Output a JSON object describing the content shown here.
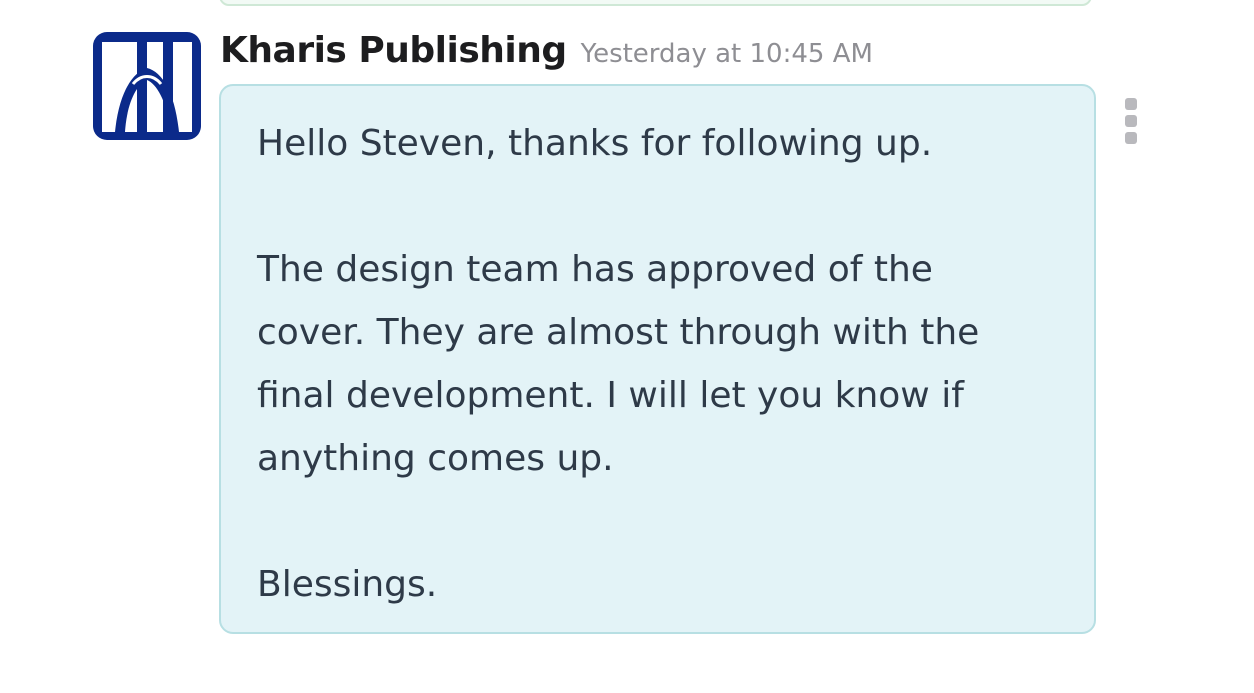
{
  "message": {
    "sender": "Kharis Publishing",
    "timestamp": "Yesterday at 10:45 AM",
    "avatar_icon": "kharis-publishing-logo-icon",
    "lines": [
      "Hello Steven, thanks for following up.",
      "",
      "The design team has approved of the",
      "cover. They are almost through with the",
      "final development. I will let you know if",
      "anything comes up.",
      "",
      "Blessings."
    ]
  },
  "colors": {
    "bubble_background": "#e3f3f7",
    "bubble_border": "#b7dfe3",
    "logo_blue": "#0b2a8a",
    "timestamp": "#8e8e93",
    "message_text": "#2e3a48"
  },
  "actions": {
    "more_icon": "vertical-ellipsis-icon"
  }
}
